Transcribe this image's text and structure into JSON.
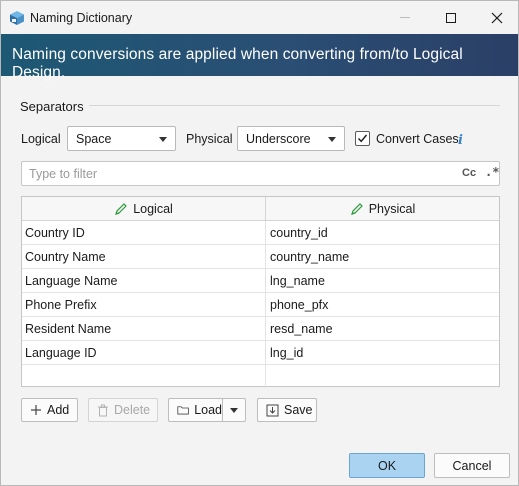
{
  "window": {
    "title": "Naming Dictionary",
    "icon": "app-cube-icon"
  },
  "banner": {
    "text": "Naming conversions are applied when converting from/to Logical Design."
  },
  "separators": {
    "section_label": "Separators",
    "logical_label": "Logical",
    "logical_value": "Space",
    "physical_label": "Physical",
    "physical_value": "Underscore",
    "convert_cases_label": "Convert Cases",
    "convert_cases_checked": true
  },
  "filter": {
    "placeholder": "Type to filter",
    "value": "",
    "case_toggle_label": "Cc",
    "regex_toggle_label": ".*"
  },
  "table": {
    "columns": [
      "Logical",
      "Physical"
    ],
    "rows": [
      {
        "logical": "Country ID",
        "physical": "country_id"
      },
      {
        "logical": "Country Name",
        "physical": "country_name"
      },
      {
        "logical": "Language Name",
        "physical": "lng_name"
      },
      {
        "logical": "Phone Prefix",
        "physical": "phone_pfx"
      },
      {
        "logical": "Resident Name",
        "physical": "resd_name"
      },
      {
        "logical": "Language ID",
        "physical": "lng_id"
      },
      {
        "logical": "",
        "physical": ""
      }
    ]
  },
  "toolbar": {
    "add_label": "Add",
    "delete_label": "Delete",
    "load_label": "Load",
    "save_label": "Save"
  },
  "footer": {
    "ok_label": "OK",
    "cancel_label": "Cancel"
  },
  "colors": {
    "banner_start": "#1d5874",
    "banner_end": "#2b3f66",
    "ok_button": "#a9d3f0",
    "accent_green": "#2e9a3c"
  }
}
